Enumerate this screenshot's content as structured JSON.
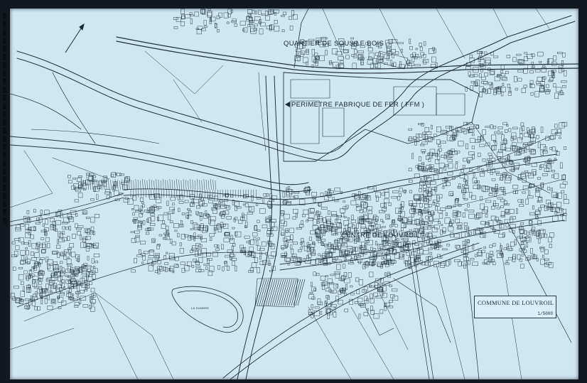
{
  "map": {
    "labels": {
      "quartier": "QUARTIER DE SOUS LE BOIS",
      "perimetre": "PERIMETRE FABRIQUE DE FER ( FFM )",
      "centre": "CENTRE DE LOUVROIL",
      "small_road": "LA SAMBRE"
    },
    "legend": {
      "title": "COMMUNE DE LOUVROIL",
      "code": "1/5000"
    },
    "icons": {
      "north_arrow": "north-arrow-icon",
      "pointer": "left-triangle-icon"
    },
    "colors": {
      "paper": "#cfe7f3",
      "ink": "#23313e",
      "frame": "#111820"
    }
  }
}
